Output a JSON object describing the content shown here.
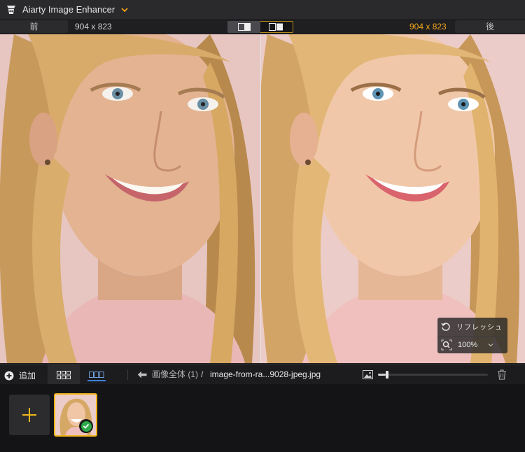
{
  "app": {
    "title": "Aiarty Image Enhancer",
    "logo_icon": "aiarty-logo-icon",
    "title_menu_icon": "chevron-down-icon"
  },
  "compare": {
    "before_label": "前",
    "after_label": "後",
    "before_dimensions": "904 x 823",
    "after_dimensions": "904 x 823",
    "modes": [
      "split-view-icon",
      "side-by-side-icon"
    ],
    "active_mode_index": 1
  },
  "zoom_panel": {
    "refresh_label": "リフレッシュ",
    "zoom_value": "100%"
  },
  "toolbar": {
    "add_label": "追加",
    "breadcrumb_all": "画像全体 (1)",
    "breadcrumb_separator": "/",
    "file_name": "image-from-ra...9028-jpeg.jpg",
    "thumbnail_size_fraction": 0.07
  },
  "tray": {
    "items": [
      {
        "status": "done"
      }
    ]
  },
  "colors": {
    "accent_orange": "#f2a51b",
    "thumb_border": "#f2b51b",
    "tab_underline": "#3d7ed6",
    "check_green": "#2eaa4a"
  }
}
